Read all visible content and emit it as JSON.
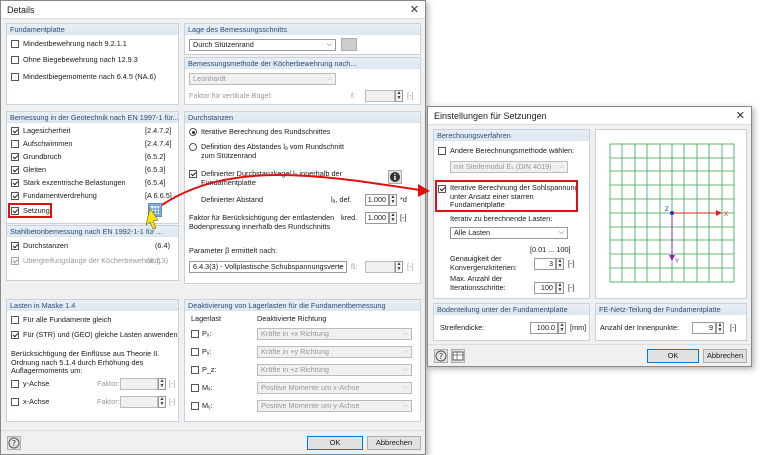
{
  "main": {
    "title": "Details",
    "fund": {
      "title": "Fundamentplatte",
      "items": [
        {
          "label": "Mindestbewehrung nach 9.2.1.1",
          "checked": false
        },
        {
          "label": "Ohne Biegebewehrung nach 12.9.3",
          "checked": false
        },
        {
          "label": "Mindestbiegemomente nach 6.4.5 (NA.6)",
          "checked": false
        }
      ]
    },
    "geo": {
      "title": "Bemessung in der Geotechnik nach EN 1997-1 für...",
      "items": [
        {
          "label": "Lagesicherheit",
          "ref": "[2.4.7.2]",
          "checked": true
        },
        {
          "label": "Aufschwimmen",
          "ref": "[2.4.7.4]",
          "checked": false
        },
        {
          "label": "Grundbruch",
          "ref": "[6.5.2]",
          "checked": true
        },
        {
          "label": "Gleiten",
          "ref": "[6.5.3]",
          "checked": true
        },
        {
          "label": "Stark exzentrische Belastungen",
          "ref": "[6.5.4]",
          "checked": true
        },
        {
          "label": "Fundamentverdrehung",
          "ref": "[A 6.6.5]",
          "checked": true
        },
        {
          "label": "Setzung",
          "ref": "",
          "checked": true
        }
      ]
    },
    "stahl": {
      "title": "Stahlbetonbemessung nach EN 1992-1-1 für ...",
      "items": [
        {
          "label": "Durchstanzen",
          "ref": "(6.4)",
          "checked": true
        },
        {
          "label": "Übergreifungslänge der Köcherbewehrung",
          "ref": "(8.7.3)",
          "checked": true
        }
      ]
    },
    "last": {
      "title": "Lasten in Maske 1.4",
      "items": [
        {
          "label": "Für alle Fundamente gleich",
          "checked": false
        },
        {
          "label": "Für (STR) und (GEO) gleiche Lasten anwenden",
          "checked": true
        }
      ],
      "note": "Berücksichtigung der Einflüsse aus Theorie II. Ordnung nach 5.1.4 durch Erhöhung des Auflagermoments um:",
      "axes": [
        {
          "label": "y-Achse",
          "factor_label": "Faktor:",
          "unit": "[-]"
        },
        {
          "label": "x-Achse",
          "factor_label": "Faktor:",
          "unit": "[-]"
        }
      ]
    },
    "lage": {
      "title": "Lage des Bemessungsschnitts",
      "value": "Durch Stützenrand"
    },
    "methode": {
      "title": "Bemessungsmethode der Köcherbewehrung nach...",
      "value": "Leonhardt",
      "factor_label": "Faktor für vertikale Bügel:",
      "factor_sym": "f:",
      "unit": "[-]"
    },
    "durch": {
      "title": "Durchstanzen",
      "radio1": "Iterative Berechnung des Rundschnittes",
      "radio2": "Definition des Abstandes lₐ vom Rundschnitt zum Stützenrand",
      "cb": "Definierter Durchstanzkegel lₐ innerhalb der Fundamentplatte",
      "abstand_label": "Definierter Abstand",
      "abstand_sym": "lₐ, def.",
      "abstand_value": "1.000",
      "abstand_unit": "*d",
      "faktor_label": "Faktor für Berücksichtigung der entlastenden Bodenpressung innerhalb des Rundschnitts",
      "faktor_sym": "kred.",
      "faktor_value": "1.000",
      "faktor_unit": "[-]",
      "param_label": "Parameter β ermittelt nach:",
      "param_value": "6.4.3(3) - Vollplastische Schubspannungsverte",
      "param_sym": "ß:",
      "param_unit": "[-]"
    },
    "deakt": {
      "title": "Deaktivierung von Lagerlasten für die Fundamentbemessung",
      "col1": "Lagerlast",
      "col2": "Deaktivierte Richtung",
      "rows": [
        {
          "label": "Pₓ:",
          "value": "Kräfte in +x Richtung"
        },
        {
          "label": "Pᵧ:",
          "value": "Kräfte in +y Richtung"
        },
        {
          "label": "P_z:",
          "value": "Kräfte in +z Richtung"
        },
        {
          "label": "Mₓ:",
          "value": "Positive Momente um x-Achse"
        },
        {
          "label": "Mᵧ:",
          "value": "Positive Momente um y-Achse"
        }
      ]
    },
    "ok": "OK",
    "cancel": "Abbrechen"
  },
  "sub": {
    "title": "Einstellungen für Setzungen",
    "berech": {
      "title": "Berechnungsverfahren",
      "cb1": "Andere Berechnungsmethode wählen:",
      "cb1_select": "mit Steifemodul Eₛ (DIN 4019)",
      "cb2": "Iterative Berechnung der Sohlspannung unter Ansatz einer starren Fundamentplatte",
      "last_label": "Iterativ zu berechnende Lasten:",
      "last_value": "Alle Lasten",
      "range": "[0.01 ... 100]",
      "genau_label": "Genauigkeit der Konvergenzkriterien:",
      "genau_value": "3",
      "genau_unit": "[-]",
      "max_label": "Max. Anzahl der Iterationsschritte:",
      "max_value": "100",
      "max_unit": "[-]"
    },
    "boden": {
      "title": "Bodenteilung unter der Fundamentplatte",
      "label": "Streifendicke:",
      "value": "100.0",
      "unit": "[mm]"
    },
    "fe": {
      "title": "FE-Netz-Teilung der Fundamentplatte",
      "label": "Anzahl der Innenpunkte:",
      "value": "9",
      "unit": "[-]"
    },
    "axis_x": "X",
    "axis_y": "Y",
    "axis_z": "Z",
    "ok": "OK",
    "cancel": "Abbrechen"
  }
}
